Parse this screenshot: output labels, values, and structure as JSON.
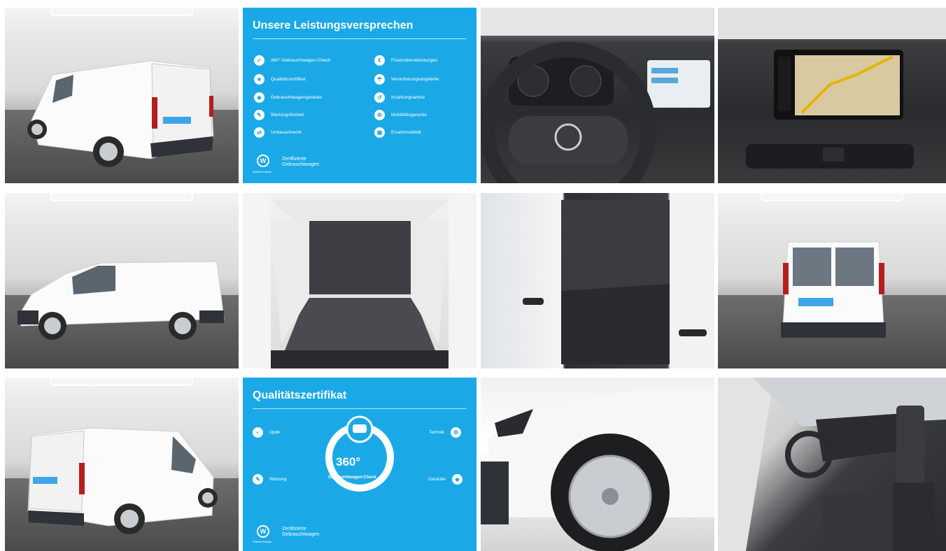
{
  "benefits_panel": {
    "title": "Unsere Leistungsversprechen",
    "items_left": [
      "360° Gebrauchtwagen-Check",
      "Qualitätszertifikat",
      "Gebrauchtwagengarantie",
      "Wartungsfreiheit",
      "Umtauschrecht"
    ],
    "items_right": [
      "Finanzdienstleistungen",
      "Versicherungsangebote",
      "Inzahlungnahme",
      "Mobilitätsgarantie",
      "Ersatzmobilität"
    ],
    "brand_line1": "Zertifizierte",
    "brand_line2": "Gebrauchtwagen",
    "brand_small": "Weltwelt leasinge"
  },
  "certificate_panel": {
    "title": "Qualitätszertifikat",
    "optik": "Optik",
    "wartung": "Wartung",
    "technik": "Technik",
    "garantie": "Garantie",
    "center_number": "360°",
    "center_caption": "Gebrauchtwagen-Check",
    "brand_line1": "Zertifizierte",
    "brand_line2": "Gebrauchtwagen",
    "brand_small": "Weltwelt leasinge"
  },
  "colors": {
    "panel_blue": "#1aa9e6",
    "van_white": "#ffffff",
    "trim_dark": "#2f3238"
  }
}
